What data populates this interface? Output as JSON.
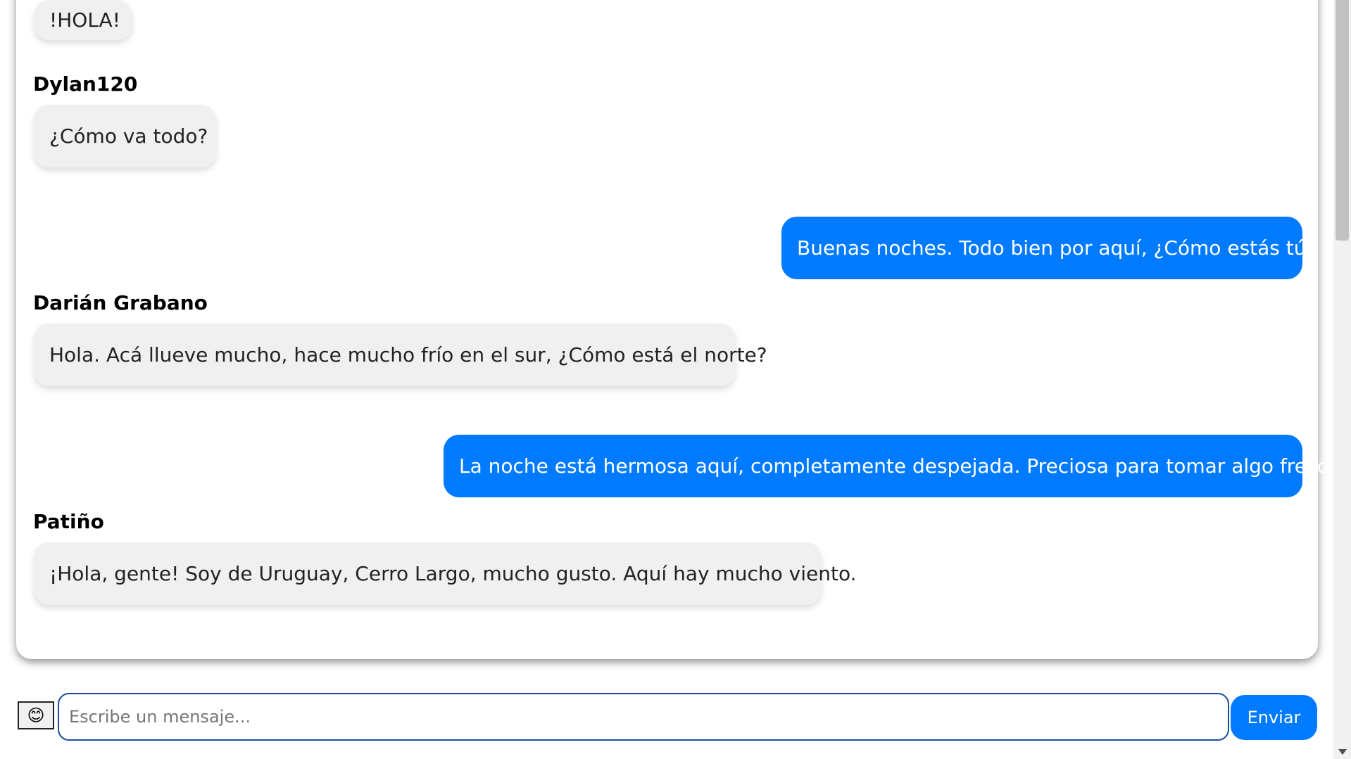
{
  "messages": [
    {
      "sender": "",
      "text": "!HOLA!",
      "direction": "in"
    },
    {
      "sender": "Dylan120",
      "text": "¿Cómo va todo?",
      "direction": "in"
    },
    {
      "sender": "",
      "text": "Buenas noches. Todo bien por aquí, ¿Cómo estás tú?",
      "direction": "out"
    },
    {
      "sender": "Darián Grabano",
      "text": "Hola. Acá llueve mucho, hace mucho frío en el sur, ¿Cómo está el norte?",
      "direction": "in"
    },
    {
      "sender": "",
      "text": "La noche está hermosa aquí, completamente despejada. Preciosa para tomar algo fresco.",
      "direction": "out"
    },
    {
      "sender": "Patiño",
      "text": "¡Hola, gente! Soy de Uruguay, Cerro Largo, mucho gusto. Aquí hay mucho viento.",
      "direction": "in"
    }
  ],
  "input_bar": {
    "emoji_button": "😊",
    "placeholder": "Escribe un mensaje...",
    "value": "",
    "send_label": "Enviar"
  },
  "colors": {
    "outgoing_bubble": "#007bff",
    "incoming_bubble": "#f0f0f0",
    "send_button": "#007bff",
    "input_border": "#1a4f9a"
  },
  "icons": {
    "emoji_button": "smiling-face-icon"
  }
}
